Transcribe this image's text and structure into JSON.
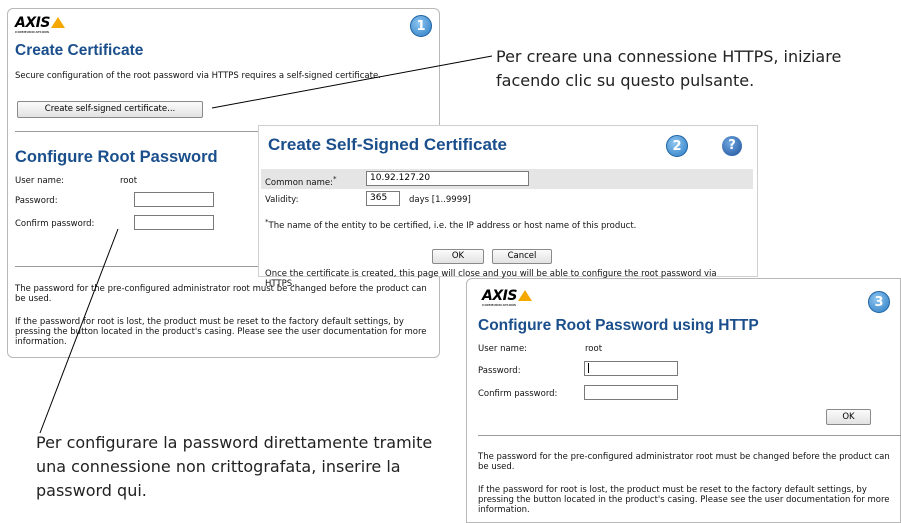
{
  "panel1": {
    "logo": "AXIS",
    "logo_sub": "COMMUNICATIONS",
    "step": "1",
    "cert_title": "Create Certificate",
    "cert_desc": "Secure configuration of the root password via HTTPS requires a self-signed certificate.",
    "cert_button": "Create self-signed certificate...",
    "root_title": "Configure Root Password",
    "user_label": "User name:",
    "user_value": "root",
    "password_label": "Password:",
    "confirm_label": "Confirm password:",
    "note1": "The password for the pre-configured administrator root must be changed before the product can be used.",
    "note2": "If the password for root is lost, the product must be reset to the factory default settings, by pressing the button located in the product's casing. Please see the user documentation for more information."
  },
  "panel2": {
    "title": "Create Self-Signed Certificate",
    "step": "2",
    "help": "?",
    "common_name_label": "Common name:",
    "common_name_value": "10.92.127.20",
    "validity_label": "Validity:",
    "validity_value": "365",
    "validity_unit": "days [1..9999]",
    "footnote": "The name of the entity to be certified, i.e. the IP address or host name of this product.",
    "ok": "OK",
    "cancel": "Cancel",
    "info": "Once the certificate is created, this page will close and you will be able to configure the root password via HTTPS."
  },
  "panel3": {
    "logo": "AXIS",
    "logo_sub": "COMMUNICATIONS",
    "step": "3",
    "title": "Configure Root Password using HTTP",
    "user_label": "User name:",
    "user_value": "root",
    "password_label": "Password:",
    "confirm_label": "Confirm password:",
    "ok": "OK",
    "note1": "The password for the pre-configured administrator root must be changed before the product can be used.",
    "note2": "If the password for root is lost, the product must be reset to the factory default settings, by pressing the button located in the product's casing. Please see the user documentation for more information."
  },
  "callouts": {
    "https": "Per creare una connessione HTTPS, iniziare facendo clic su questo pulsante.",
    "password": "Per configurare la password direttamente tramite una connessione non crittografata, inserire la password qui."
  },
  "colors": {
    "heading": "#1b4f8c",
    "badge": "#2a7bc4",
    "logo_triangle": "#f5a800"
  }
}
